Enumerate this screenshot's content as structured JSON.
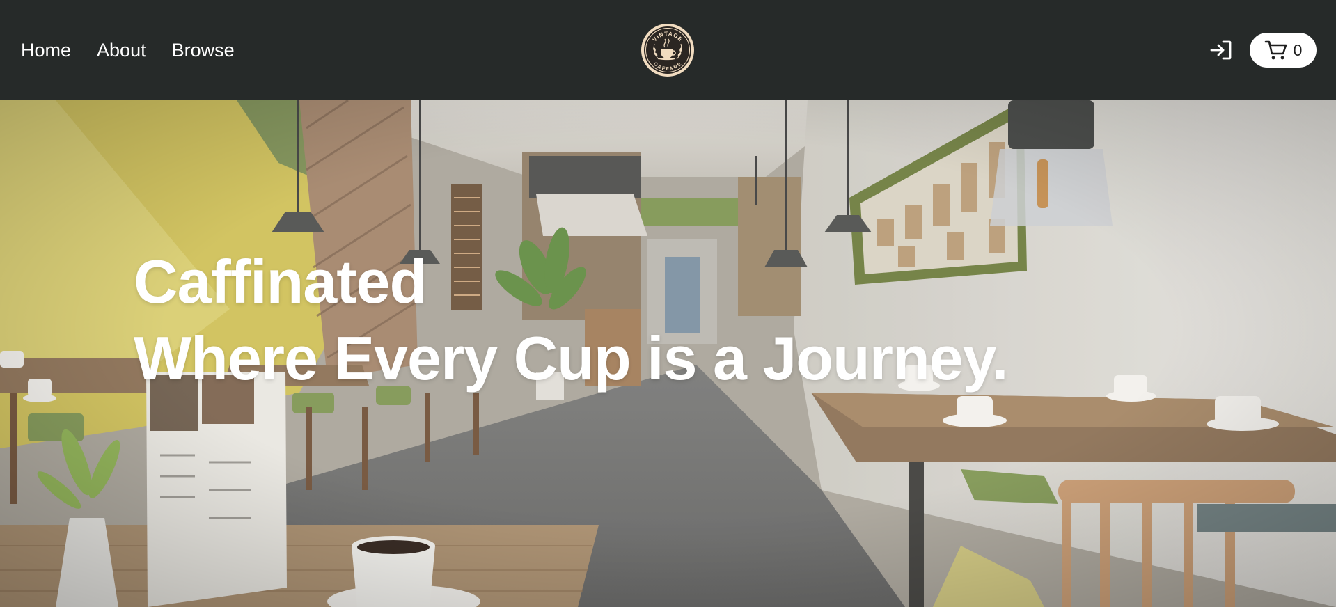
{
  "nav": {
    "links": [
      {
        "label": "Home"
      },
      {
        "label": "About"
      },
      {
        "label": "Browse"
      }
    ]
  },
  "logo": {
    "top_text": "VINTAGE",
    "bottom_text": "CAFFANE",
    "icon": "coffee-cup-icon"
  },
  "actions": {
    "login_icon": "login-icon",
    "cart_icon": "cart-icon",
    "cart_count": "0"
  },
  "hero": {
    "line1": "Caffinated",
    "line2": "Where Every Cup is a Journey."
  },
  "colors": {
    "navbar_bg": "#262a29",
    "text_white": "#ffffff",
    "accent_yellow": "#d8c95a",
    "accent_green": "#7f9a5a"
  }
}
